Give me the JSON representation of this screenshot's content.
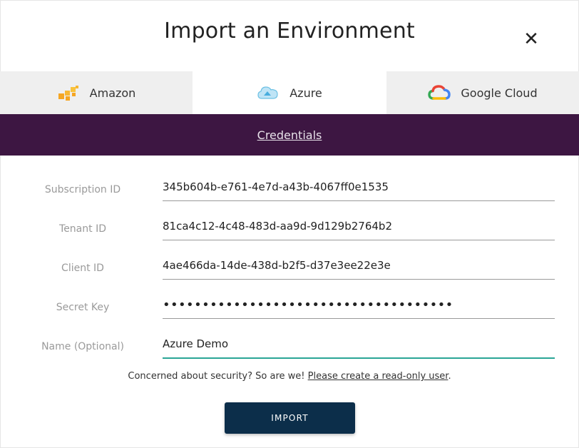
{
  "dialog": {
    "title": "Import an Environment",
    "close_label": "✕"
  },
  "tabs": [
    {
      "label": "Amazon",
      "icon": "aws-icon",
      "active": false
    },
    {
      "label": "Azure",
      "icon": "azure-cloud-icon",
      "active": true
    },
    {
      "label": "Google Cloud",
      "icon": "google-cloud-icon",
      "active": false
    }
  ],
  "section": {
    "credentials_link": "Credentials"
  },
  "form": {
    "subscription": {
      "label": "Subscription ID",
      "value": "345b604b-e761-4e7d-a43b-4067ff0e1535"
    },
    "tenant": {
      "label": "Tenant ID",
      "value": "81ca4c12-4c48-483d-aa9d-9d129b2764b2"
    },
    "client": {
      "label": "Client ID",
      "value": "4ae466da-14de-438d-b2f5-d37e3ee22e3e"
    },
    "secret": {
      "label": "Secret Key",
      "value": "•••••••••••••••••••••••••••••••••••••"
    },
    "name": {
      "label": "Name (Optional)",
      "value": "Azure Demo"
    }
  },
  "security": {
    "text": "Concerned about security? So are we!",
    "link": "Please create a read-only user",
    "suffix": "."
  },
  "actions": {
    "import_label": "IMPORT"
  },
  "colors": {
    "banner": "#3d1642",
    "focus_underline": "#2aa596",
    "button": "#0c2e4a"
  }
}
